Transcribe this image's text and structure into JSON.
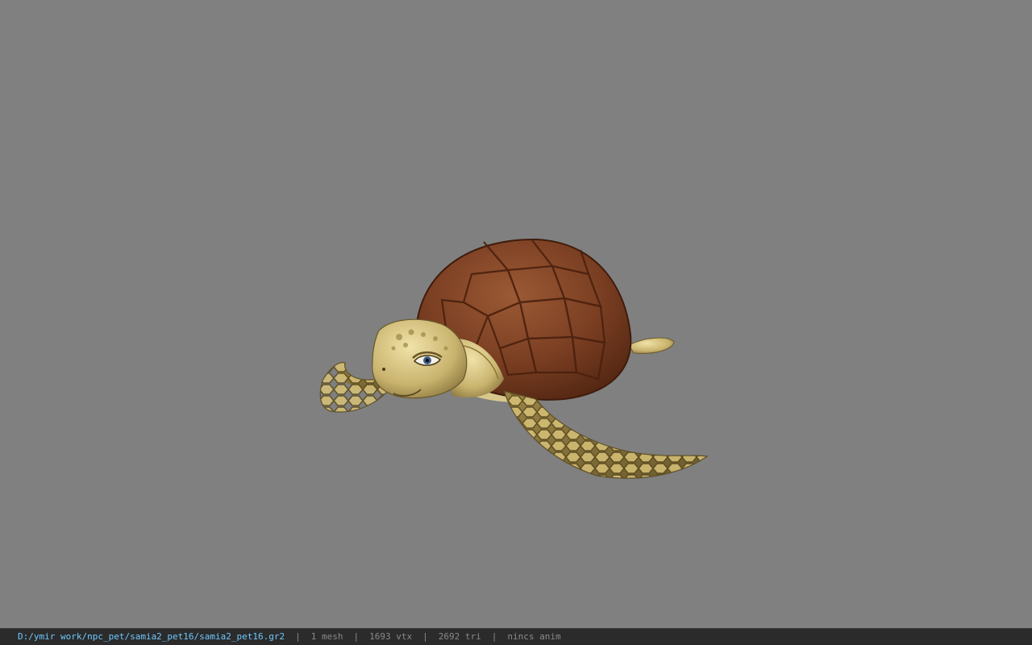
{
  "viewer": {
    "background_color": "#808080",
    "model_icon": "sea-turtle-model"
  },
  "status_bar": {
    "file_path": "D:/ymir work/npc_pet/samia2_pet16/samia2_pet16.gr2",
    "separator": "|",
    "mesh_count": "1 mesh",
    "vertex_count": "1693 vtx",
    "triangle_count": "2692 tri",
    "anim": "nincs anim",
    "path_color": "#6ec8ff"
  }
}
